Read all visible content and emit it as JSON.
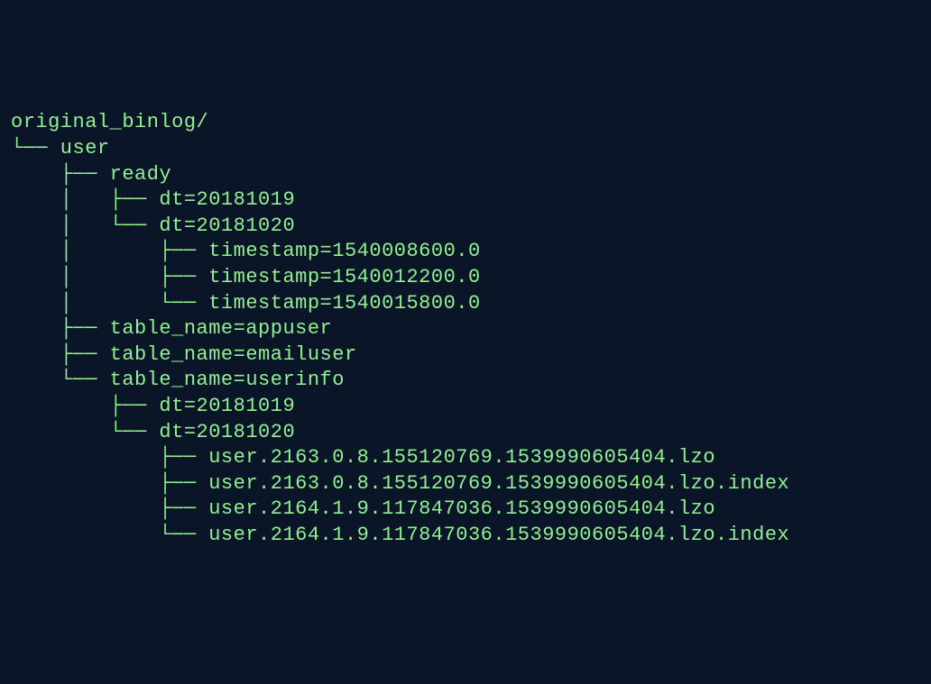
{
  "root": "original_binlog/",
  "tree": [
    {
      "prefix": "└── ",
      "text": "user"
    },
    {
      "prefix": "    ├── ",
      "text": "ready"
    },
    {
      "prefix": "    │   ├── ",
      "text": "dt=20181019"
    },
    {
      "prefix": "    │   └── ",
      "text": "dt=20181020"
    },
    {
      "prefix": "    │       ├── ",
      "text": "timestamp=1540008600.0"
    },
    {
      "prefix": "    │       ├── ",
      "text": "timestamp=1540012200.0"
    },
    {
      "prefix": "    │       └── ",
      "text": "timestamp=1540015800.0"
    },
    {
      "prefix": "    ├── ",
      "text": "table_name=appuser"
    },
    {
      "prefix": "    ├── ",
      "text": "table_name=emailuser"
    },
    {
      "prefix": "    └── ",
      "text": "table_name=userinfo"
    },
    {
      "prefix": "        ├── ",
      "text": "dt=20181019"
    },
    {
      "prefix": "        └── ",
      "text": "dt=20181020"
    },
    {
      "prefix": "            ├── ",
      "text": "user.2163.0.8.155120769.1539990605404.lzo"
    },
    {
      "prefix": "            ├── ",
      "text": "user.2163.0.8.155120769.1539990605404.lzo.index"
    },
    {
      "prefix": "            ├── ",
      "text": "user.2164.1.9.117847036.1539990605404.lzo"
    },
    {
      "prefix": "            └── ",
      "text": "user.2164.1.9.117847036.1539990605404.lzo.index"
    }
  ]
}
